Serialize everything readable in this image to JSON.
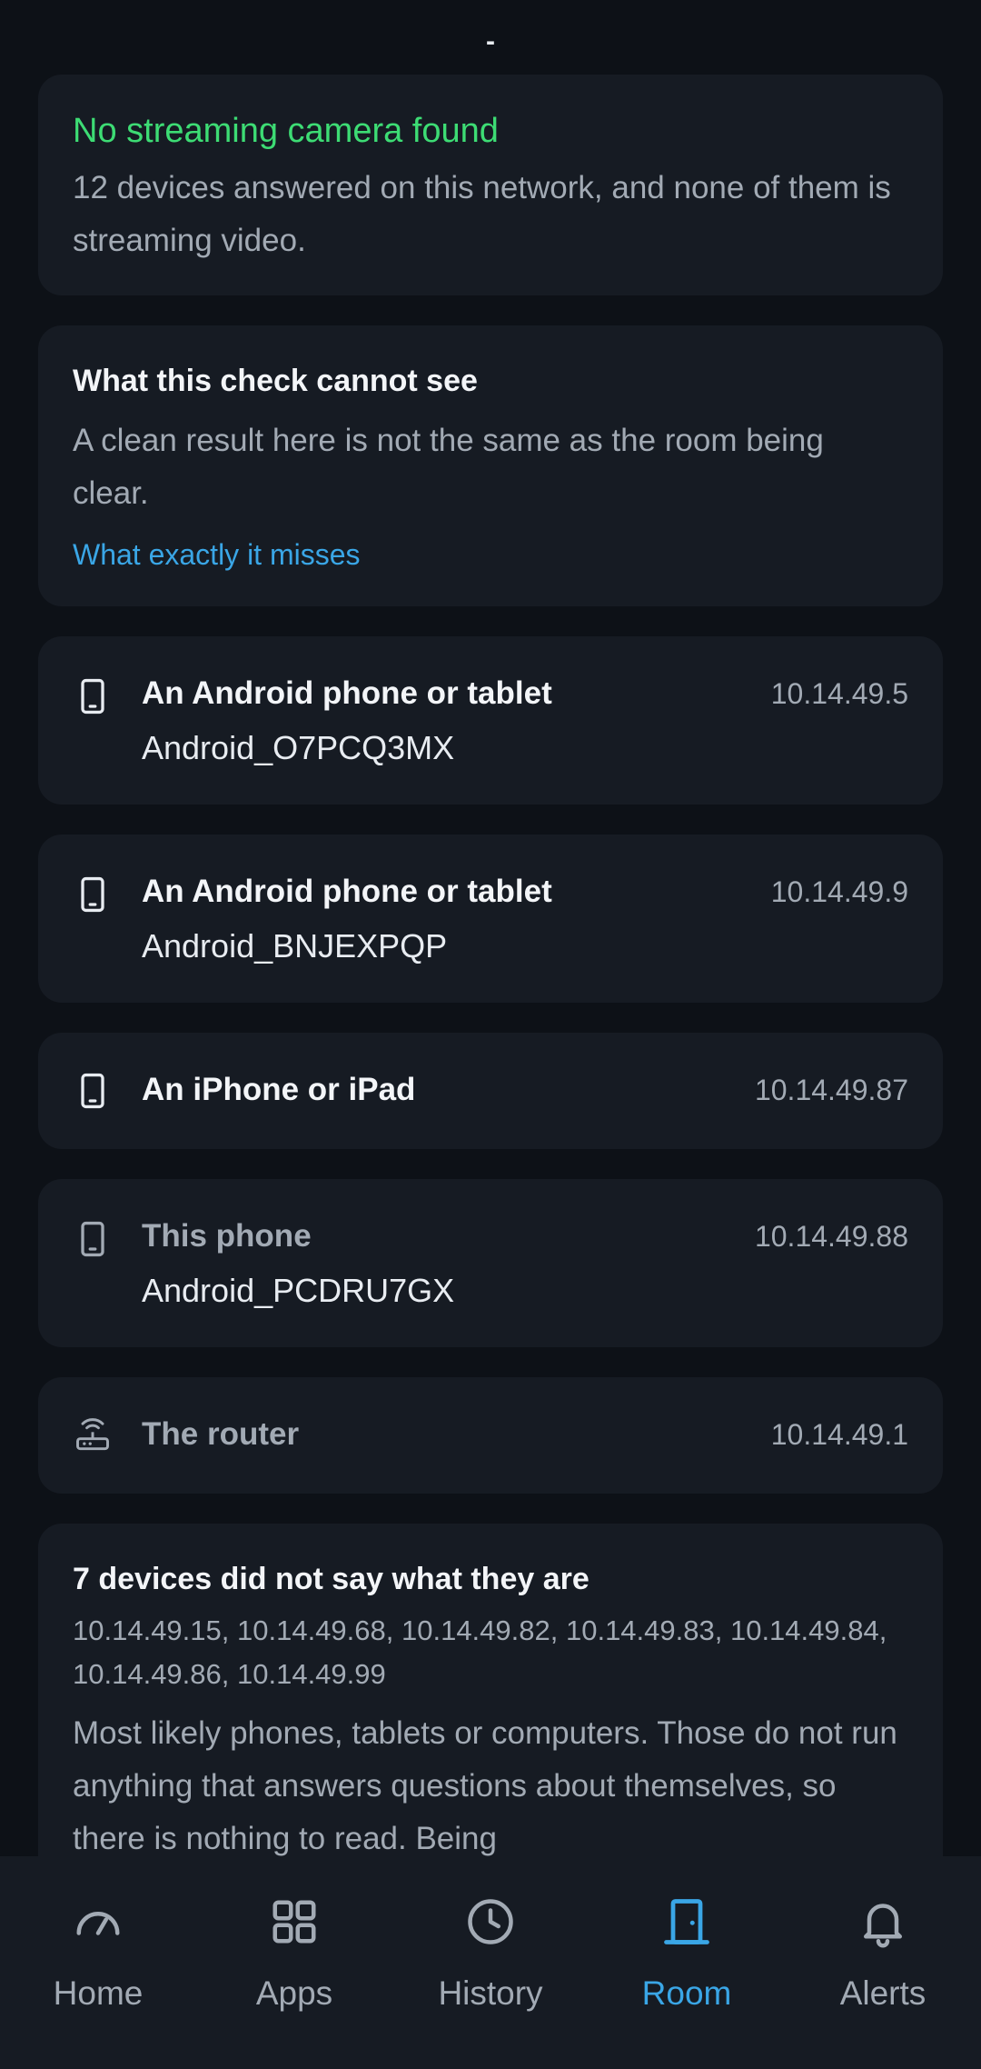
{
  "status_bar": {
    "indicator": "-"
  },
  "result": {
    "title": "No streaming camera found",
    "text": "12 devices answered on this network, and none of them is streaming video."
  },
  "limits": {
    "title": "What this check cannot see",
    "text": "A clean result here is not the same as the room being clear.",
    "link": "What exactly it misses"
  },
  "devices": [
    {
      "icon": "phone-icon",
      "type": "An Android phone or tablet",
      "name": "Android_O7PCQ3MX",
      "ip": "10.14.49.5"
    },
    {
      "icon": "phone-icon",
      "type": "An Android phone or tablet",
      "name": "Android_BNJEXPQP",
      "ip": "10.14.49.9"
    },
    {
      "icon": "phone-icon",
      "type": "An iPhone or iPad",
      "name": "",
      "ip": "10.14.49.87"
    },
    {
      "icon": "phone-icon",
      "type": "This phone",
      "name": "Android_PCDRU7GX",
      "ip": "10.14.49.88"
    },
    {
      "icon": "router-icon",
      "type": "The router",
      "name": "",
      "ip": "10.14.49.1"
    }
  ],
  "unknown": {
    "title": "7 devices did not say what they are",
    "ips": "10.14.49.15, 10.14.49.68, 10.14.49.82, 10.14.49.83, 10.14.49.84, 10.14.49.86, 10.14.49.99",
    "text": "Most likely phones, tablets or computers. Those do not run anything that answers questions about themselves, so there is nothing to read. Being"
  },
  "nav": {
    "items": [
      {
        "label": "Home",
        "icon": "gauge-icon"
      },
      {
        "label": "Apps",
        "icon": "grid-icon"
      },
      {
        "label": "History",
        "icon": "clock-icon"
      },
      {
        "label": "Room",
        "icon": "door-icon"
      },
      {
        "label": "Alerts",
        "icon": "bell-icon"
      }
    ],
    "active": "Room"
  },
  "colors": {
    "background": "#0d1117",
    "card": "#161b23",
    "success": "#3ddc74",
    "accent": "#3aa6e6",
    "muted_text": "#a2aab4"
  }
}
